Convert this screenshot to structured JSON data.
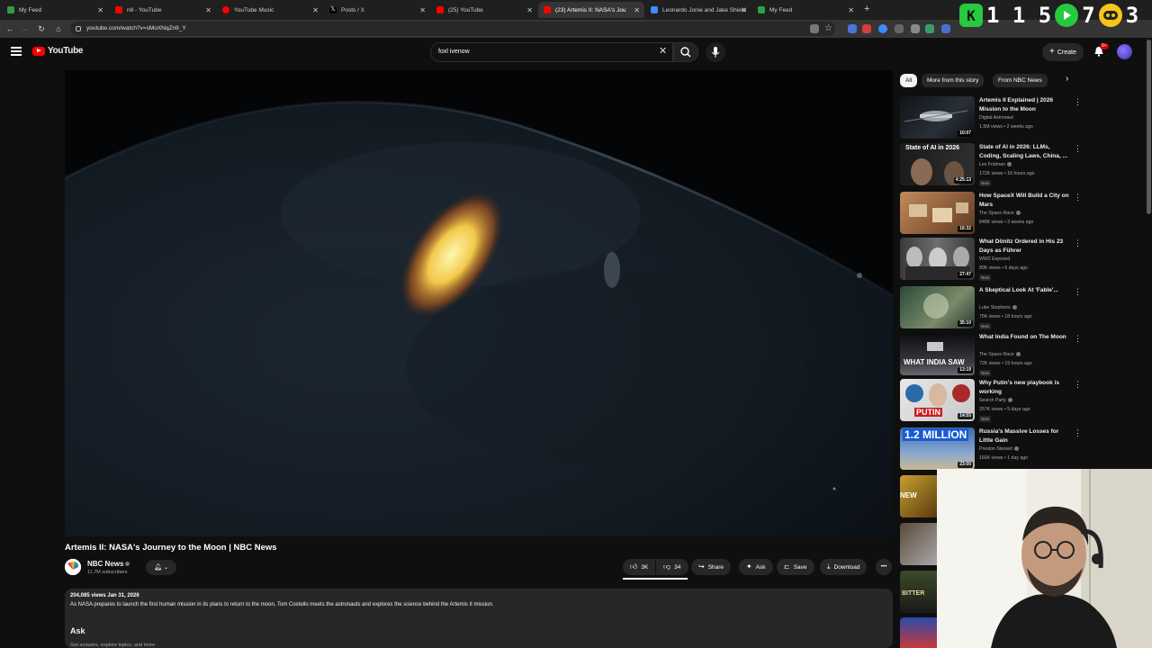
{
  "browser": {
    "tabs": [
      {
        "label": "My Feed",
        "fav": "#2ea043",
        "close": "✕"
      },
      {
        "label": "n8 - YouTube",
        "fav": "#ff0000",
        "close": "✕"
      },
      {
        "label": "YouTube Music",
        "fav": "#ff0000",
        "close": "✕"
      },
      {
        "label": "Posts / X",
        "fav": "#ffffff",
        "close": "✕"
      },
      {
        "label": "(25) YouTube",
        "fav": "#ff0000",
        "close": "✕"
      },
      {
        "label": "(23) Artemis II: NASA's Jou",
        "fav": "#ff0000",
        "close": "✕"
      },
      {
        "label": "Leonardo Jonie and Jake Shield",
        "fav": "#3d8bfd",
        "close": "✕"
      },
      {
        "label": "My Feed",
        "fav": "#2ea043",
        "close": "✕"
      }
    ],
    "new_tab": "+",
    "url": "youtube.com/watch?v=sMoXNqZn9_Y"
  },
  "overlay": {
    "k_badge": "K",
    "count_1": "1 1 5",
    "count_2": "7",
    "count_3": "3"
  },
  "masthead": {
    "logo": "YouTube",
    "search_value": "foxl ivenow",
    "clear": "✕",
    "create_label": "Create",
    "notif_badge": "9+"
  },
  "video": {
    "title": "Artemis II: NASA's Journey to the Moon | NBC News",
    "channel": "NBC News",
    "subscribers": "11.7M subscribers",
    "like_count": "3K",
    "dislike_count": "34",
    "share_label": "Share",
    "ask_label": "Ask",
    "save_label": "Save",
    "download_label": "Download"
  },
  "description": {
    "meta": "204,085 views  Jan 31, 2026",
    "text": "As NASA prepares to launch the first human mission in its plans to return to the moon, Tom Costello meets the astronauts and explores the science behind the Artemis II mission.",
    "ask_heading": "Ask",
    "ask_sub": "Get answers, explore topics, and more"
  },
  "chips": [
    "All",
    "More from this story",
    "From NBC News"
  ],
  "recommendations": [
    {
      "title": "Artemis II Explained | 2026 Mission to the Moon",
      "channel": "Digital Astronaut",
      "meta": "1.5M views • 2 weeks ago",
      "duration": "10:07",
      "new": ""
    },
    {
      "title": "State of AI in 2026: LLMs, Coding, Scaling Laws, China, ...",
      "channel": "Lex Fridman",
      "meta": "172K views • 16 hours ago",
      "duration": "4:25:13",
      "new": "New",
      "thumb_text": "State of AI in 2026"
    },
    {
      "title": "How SpaceX Will Build a City on Mars",
      "channel": "The Space Race",
      "meta": "848K views • 3 weeks ago",
      "duration": "16:32",
      "new": ""
    },
    {
      "title": "What Dönitz Ordered in His 23 Days as Führer",
      "channel": "WW2 Exposed",
      "meta": "89K views • 6 days ago",
      "duration": "27:47",
      "new": "New"
    },
    {
      "title": "A Skeptical Look At 'Fable'...",
      "channel": "Luke Stephens",
      "meta": "75K views • 18 hours ago",
      "duration": "35:10",
      "new": "New"
    },
    {
      "title": "What India Found on The Moon",
      "channel": "The Space Race",
      "meta": "72K views • 19 hours ago",
      "duration": "13:19",
      "new": "New",
      "thumb_text": "WHAT INDIA SAW"
    },
    {
      "title": "Why Putin's new playbook is working",
      "channel": "Search Party",
      "meta": "257K views • 5 days ago",
      "duration": "14:55",
      "new": "New",
      "thumb_text": "PUTIN"
    },
    {
      "title": "Russia's Massive Losses for Little Gain",
      "channel": "Preston Stewart",
      "meta": "166K views • 1 day ago",
      "duration": "23:00",
      "new": "",
      "thumb_text": "1.2 MILLION"
    }
  ],
  "partial_thumbs": [
    "NEW",
    "",
    "BITTER"
  ],
  "colors": {
    "accent": "#ff0000",
    "bg": "#0f0f0f",
    "surface": "#272727"
  }
}
